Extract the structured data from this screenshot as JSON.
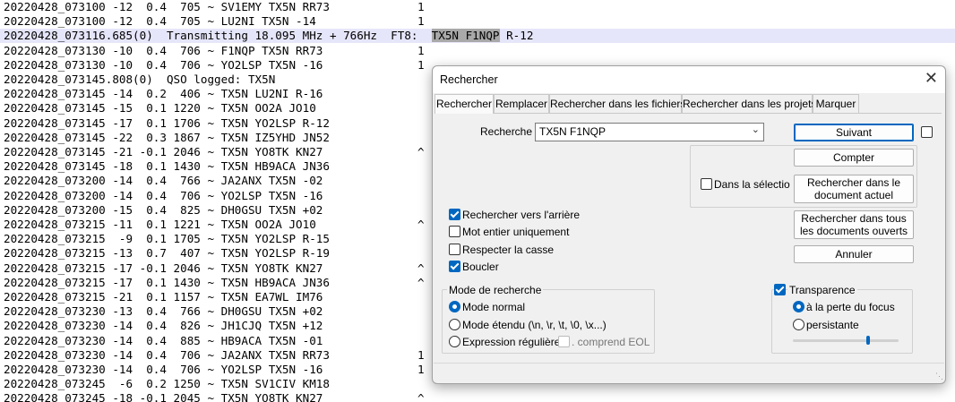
{
  "log": {
    "lines": [
      "20220428_073100 -12  0.4  705 ~ SV1EMY TX5N RR73",
      "20220428_073100 -12  0.4  705 ~ LU2NI TX5N -14",
      "20220428_073116.685(0)  Transmitting 18.095 MHz + 766Hz  FT8:  ",
      "20220428_073130 -10  0.4  706 ~ F1NQP TX5N RR73",
      "20220428_073130 -10  0.4  706 ~ YO2LSP TX5N -16",
      "20220428_073145.808(0)  QSO logged: TX5N",
      "20220428_073145 -14  0.2  406 ~ TX5N LU2NI R-16",
      "20220428_073145 -15  0.1 1220 ~ TX5N OO2A JO10",
      "20220428_073145 -17  0.1 1706 ~ TX5N YO2LSP R-12",
      "20220428_073145 -22  0.3 1867 ~ TX5N IZ5YHD JN52",
      "20220428_073145 -21 -0.1 2046 ~ TX5N YO8TK KN27",
      "20220428_073145 -18  0.1 1430 ~ TX5N HB9ACA JN36",
      "20220428_073200 -14  0.4  766 ~ JA2ANX TX5N -02",
      "20220428_073200 -14  0.4  706 ~ YO2LSP TX5N -16",
      "20220428_073200 -15  0.4  825 ~ DH0GSU TX5N +02",
      "20220428_073215 -11  0.1 1221 ~ TX5N OO2A JO10",
      "20220428_073215  -9  0.1 1705 ~ TX5N YO2LSP R-15",
      "20220428_073215 -13  0.7  407 ~ TX5N YO2LSP R-19",
      "20220428_073215 -17 -0.1 2046 ~ TX5N YO8TK KN27",
      "20220428_073215 -17  0.1 1430 ~ TX5N HB9ACA JN36",
      "20220428_073215 -21  0.1 1157 ~ TX5N EA7WL IM76",
      "20220428_073230 -13  0.4  766 ~ DH0GSU TX5N +02",
      "20220428_073230 -14  0.4  826 ~ JH1CJQ TX5N +12",
      "20220428_073230 -14  0.4  885 ~ HB9ACA TX5N -01",
      "20220428_073230 -14  0.4  706 ~ JA2ANX TX5N RR73",
      "20220428_073230 -14  0.4  706 ~ YO2LSP TX5N -16",
      "20220428_073245  -6  0.2 1250 ~ TX5N SV1CIV KM18",
      "20220428_073245 -18 -0.1 2045 ~ TX5N YO8TK KN27"
    ],
    "transmit_selected": "TX5N F1NQP",
    "transmit_after": " R-12",
    "markers": [
      {
        "row": 0,
        "text": "1"
      },
      {
        "row": 1,
        "text": "1"
      },
      {
        "row": 3,
        "text": "1"
      },
      {
        "row": 4,
        "text": "1"
      },
      {
        "row": 10,
        "text": "^"
      },
      {
        "row": 15,
        "text": "^"
      },
      {
        "row": 18,
        "text": "^"
      },
      {
        "row": 19,
        "text": "^"
      },
      {
        "row": 24,
        "text": "1"
      },
      {
        "row": 25,
        "text": "1"
      },
      {
        "row": 27,
        "text": "^"
      }
    ]
  },
  "dialog": {
    "title": "Rechercher",
    "close": "✕",
    "tabs": [
      "Rechercher",
      "Remplacer",
      "Rechercher dans les fichiers",
      "Rechercher dans les projets",
      "Marquer"
    ],
    "search_label": "Recherche :",
    "search_value": "TX5N F1NQP",
    "buttons": {
      "next": "Suivant",
      "count": "Compter",
      "find_in_current": "Rechercher dans le document actuel",
      "find_in_all": "Rechercher dans tous les documents ouverts",
      "cancel": "Annuler"
    },
    "in_selection": "Dans la sélectio",
    "options": {
      "backward": "Rechercher vers l'arrière",
      "whole_word": "Mot entier uniquement",
      "match_case": "Respecter la casse",
      "wrap": "Boucler"
    },
    "mode": {
      "title": "Mode de recherche",
      "normal": "Mode normal",
      "extended": "Mode étendu (\\n, \\r, \\t, \\0, \\x...)",
      "regex": "Expression régulière",
      "eol": ". comprend EOL"
    },
    "transparency": {
      "title": "Transparence",
      "on_focus_loss": "à la perte du focus",
      "persistent": "persistante"
    }
  }
}
